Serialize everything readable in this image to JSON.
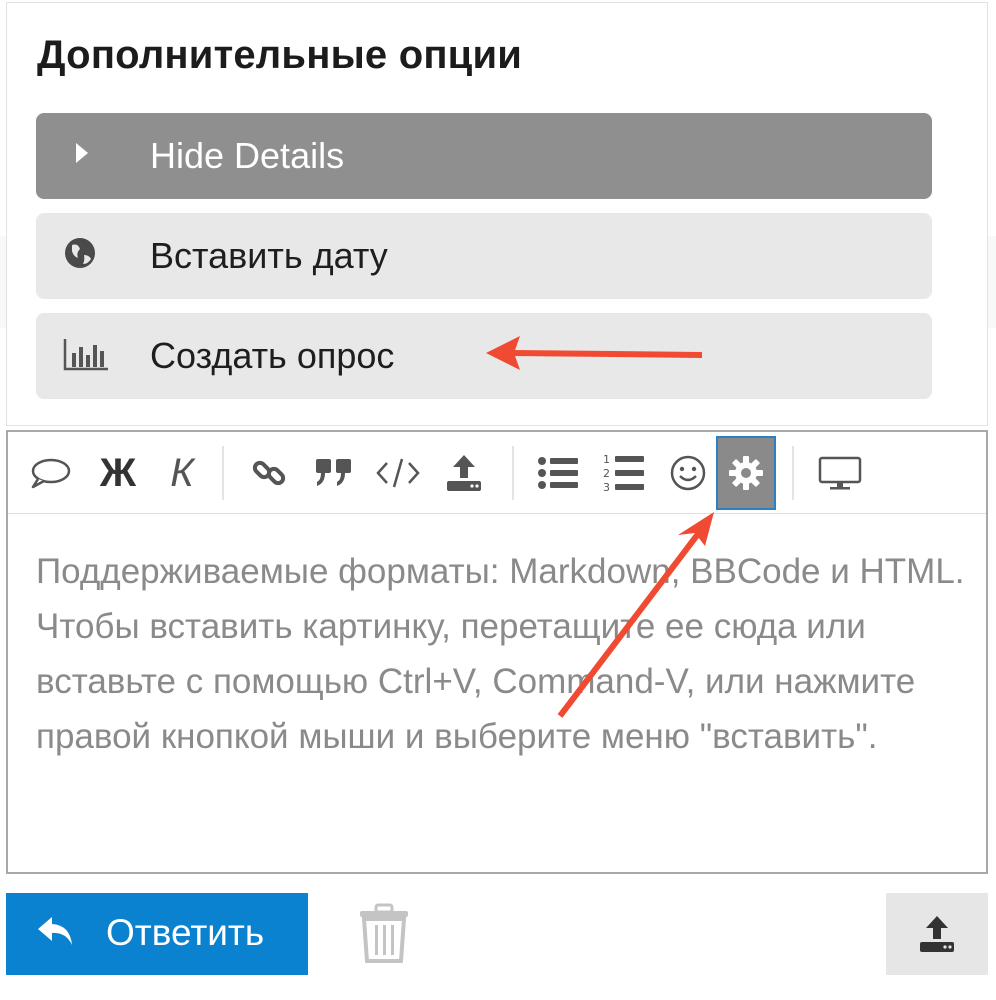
{
  "options_panel": {
    "title": "Дополнительные опции",
    "items": [
      {
        "label": "Hide Details",
        "icon": "caret-right-icon"
      },
      {
        "label": "Вставить дату",
        "icon": "globe-icon"
      },
      {
        "label": "Создать опрос",
        "icon": "bar-chart-icon"
      }
    ]
  },
  "editor": {
    "toolbar": {
      "bold_glyph": "Ж",
      "italic_glyph": "К",
      "buttons": [
        "speech-bubble-icon",
        "bold-icon",
        "italic-icon",
        "link-icon",
        "quote-icon",
        "code-icon",
        "upload-icon",
        "bullet-list-icon",
        "numbered-list-icon",
        "smiley-icon",
        "gear-icon",
        "preview-icon"
      ]
    },
    "placeholder_text": "Поддерживаемые форматы: Markdown, BBCode и HTML. Чтобы вставить картинку, перетащите ее сюда или вставьте с помощью Ctrl+V, Command-V, или нажмите правой кнопкой мыши и выберите меню \"вставить\"."
  },
  "footer": {
    "reply_label": "Ответить"
  },
  "colors": {
    "accent_blue": "#0a82cf",
    "annotation_red": "#f04a32",
    "active_item_bg": "#8f8f8f",
    "item_bg": "#e8e8e8"
  }
}
